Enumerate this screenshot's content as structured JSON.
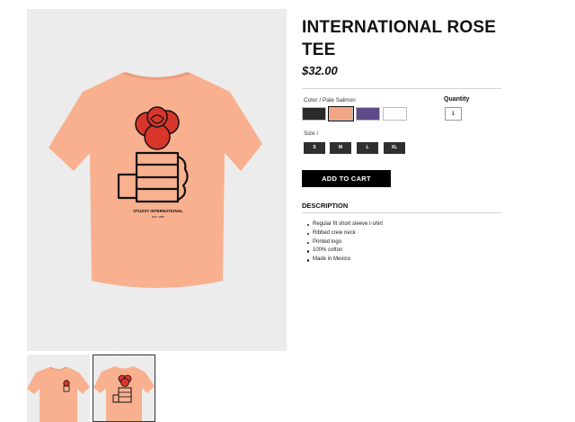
{
  "product": {
    "title": "INTERNATIONAL ROSE TEE",
    "price": "$32.00"
  },
  "color": {
    "label": "Color / Pale Salmon",
    "swatches": [
      {
        "name": "black",
        "hex": "#2a2a2a",
        "selected": false
      },
      {
        "name": "pale salmon",
        "hex": "#f2a584",
        "selected": true
      },
      {
        "name": "purple",
        "hex": "#5f4a8a",
        "selected": false
      },
      {
        "name": "white",
        "hex": "#ffffff",
        "selected": false
      }
    ]
  },
  "quantity": {
    "label": "Quantity",
    "value": "1"
  },
  "size": {
    "label": "Size /",
    "options": [
      "S",
      "M",
      "L",
      "XL"
    ]
  },
  "cart": {
    "button_label": "ADD TO CART"
  },
  "description": {
    "title": "DESCRIPTION",
    "items": [
      "Regular fit short sleeve t-shirt",
      "Ribbed crew neck",
      "Printed logo",
      "100% cotton",
      "Made in Mexico"
    ]
  },
  "graphic": {
    "brand_text": "STUSSY INTERNATIONAL",
    "est_text": "EST. 1980"
  },
  "colors": {
    "shirt": "#f9b08f",
    "shirt_shadow": "#ee9d7c",
    "rose": "#d8362a",
    "ink": "#111111",
    "image_bg": "#ececec"
  }
}
